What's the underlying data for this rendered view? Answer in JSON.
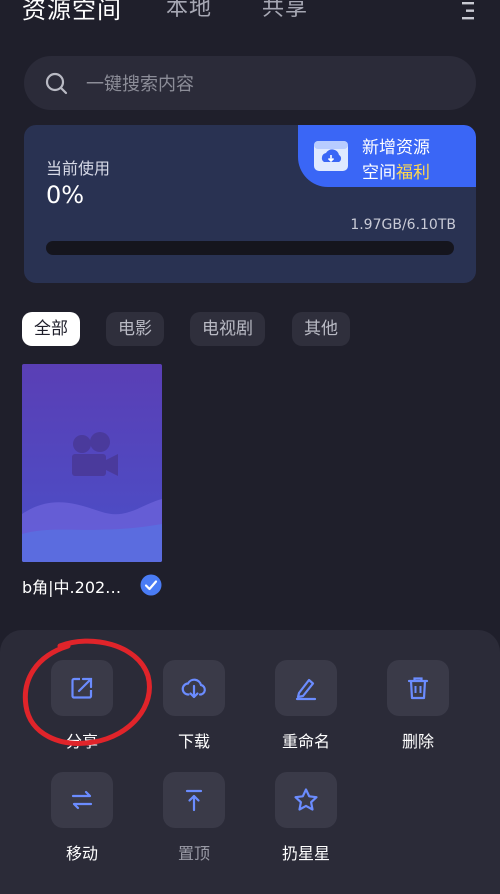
{
  "header": {
    "tabs": [
      {
        "label": "资源空间"
      },
      {
        "label": "本地"
      },
      {
        "label": "共享"
      }
    ],
    "menu_icon": "more-vertical-icon"
  },
  "search": {
    "placeholder": "一键搜索内容",
    "icon": "search-icon"
  },
  "usage": {
    "label": "当前使用",
    "percent": "0%",
    "percent_value": 0,
    "quota": "1.97GB/6.10TB",
    "promo_title": "新增资源",
    "promo_sub_prefix": "空间",
    "promo_sub_highlight": "福利"
  },
  "filters": [
    {
      "label": "全部",
      "active": true
    },
    {
      "label": "电影",
      "active": false
    },
    {
      "label": "电视剧",
      "active": false
    },
    {
      "label": "其他",
      "active": false
    }
  ],
  "files": [
    {
      "name": "b角|中.202…",
      "selected": true,
      "icon": "video-camera-icon"
    }
  ],
  "actions": [
    {
      "label": "分享",
      "icon": "share-icon"
    },
    {
      "label": "下载",
      "icon": "cloud-download-icon"
    },
    {
      "label": "重命名",
      "icon": "rename-icon"
    },
    {
      "label": "删除",
      "icon": "trash-icon"
    },
    {
      "label": "移动",
      "icon": "move-icon"
    },
    {
      "label": "置顶",
      "icon": "pin-top-icon"
    },
    {
      "label": "扔星星",
      "icon": "star-icon"
    }
  ],
  "colors": {
    "background": "#1f1f2b",
    "accent": "#3a66f6",
    "highlight": "#ffd84d",
    "check": "#4a7cf5",
    "annotation": "#e0242a"
  }
}
